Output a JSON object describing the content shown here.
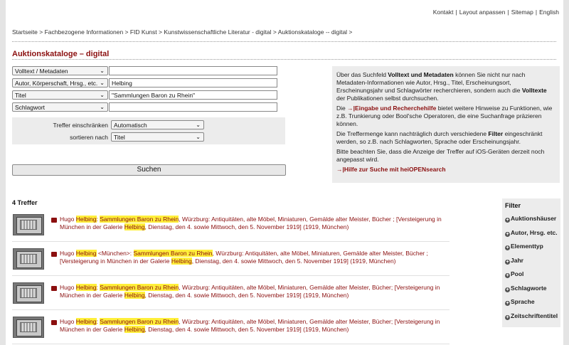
{
  "top_links": [
    "Kontakt",
    "Layout anpassen",
    "Sitemap",
    "English"
  ],
  "breadcrumb": "Startseite > Fachbezogene Informationen > FID Kunst > Kunstwissenschaftliche Literatur - digital > Auktionskataloge -- digital >",
  "page_title": "Auktionskataloge – digital",
  "search_rows": [
    {
      "field": "Volltext / Metadaten",
      "value": ""
    },
    {
      "field": "Autor, Körperschaft, Hrsg., etc.",
      "value": "Helbing"
    },
    {
      "field": "Titel",
      "value": "\"Sammlungen Baron zu Rhein\""
    },
    {
      "field": "Schlagwort",
      "value": ""
    }
  ],
  "limit": {
    "label": "Treffer einschränken",
    "value": "Automatisch"
  },
  "sort": {
    "label": "sortieren nach",
    "value": "Titel"
  },
  "search_button": "Suchen",
  "info": {
    "p1_a": "Über das Suchfeld ",
    "p1_b": "Volltext und Metadaten",
    "p1_c": " können Sie nicht nur nach Metadaten-Informationen wie Autor, Hrsg., Titel, Erscheinungsort, Erscheinungsjahr und Schlagwörter recherchieren, sondern auch die ",
    "p1_d": "Volltexte",
    "p1_e": " der Publikationen selbst durchsuchen.",
    "p2_a": "Die ",
    "p2_link": "Eingabe und Recherchehilfe",
    "p2_b": " bietet weitere Hinweise zu Funktionen, wie z.B. Trunkierung oder Bool'sche Operatoren, die eine Suchanfrage präzieren können.",
    "p3_a": "Die Treffermenge kann nachträglich durch verschiedene ",
    "p3_b": "Filter",
    "p3_c": " eingeschränkt werden, so z.B. nach Schlagworten, Sprache oder Erscheinungsjahr.",
    "p4": "Bitte beachten Sie, dass die Anzeige der Treffer auf iOS-Geräten derzeit noch angepasst wird.",
    "help_link": "Hilfe zur Suche mit heiOPENsearch"
  },
  "result_count": "4 Treffer",
  "results": [
    {
      "a": "Hugo ",
      "b": "Helbing",
      "c": ": ",
      "d": "Sammlungen Baron zu Rhein",
      "e": ", Würzburg: Antiquitäten, alte Möbel, Miniaturen, Gemälde alter Meister, Bücher ; [Versteigerung in München in der Galerie ",
      "f": "Helbing",
      "g": ", Dienstag, den 4. sowie Mittwoch, den 5. November 1919] (1919, München)"
    },
    {
      "a": "Hugo ",
      "b": "Helbing",
      "c": " <München>: ",
      "d": "Sammlungen Baron zu Rhein",
      "e": ", Würzburg: Antiquitäten, alte Möbel, Miniaturen, Gemälde alter Meister, Bücher ; [Versteigerung in München in der Galerie ",
      "f": "Helbing",
      "g": ", Dienstag, den 4. sowie Mittwoch, den 5. November 1919] (1919, München)"
    },
    {
      "a": "Hugo ",
      "b": "Helbing",
      "c": ": ",
      "d": "Sammlungen Baron zu Rhein",
      "e": ", Würzburg: Antiquitäten, alte Möbel, Miniaturen, Gemälde alter Meister, Bücher; [Versteigerung in München in der Galerie ",
      "f": "Helbing",
      "g": ", Dienstag, den 4. sowie Mittwoch, den 5. November 1919] (1919, München)"
    },
    {
      "a": "Hugo ",
      "b": "Helbing",
      "c": ": ",
      "d": "Sammlungen Baron zu Rhein",
      "e": ", Würzburg: Antiquitäten, alte Möbel, Miniaturen, Gemälde alter Meister, Bücher; [Versteigerung in München in der Galerie ",
      "f": "Helbing",
      "g": ", Dienstag, den 4. sowie Mittwoch, den 5. November 1919] (1919, München)"
    }
  ],
  "filter": {
    "title": "Filter",
    "items": [
      "Auktionshäuser",
      "Autor, Hrsg. etc.",
      "Elementtyp",
      "Jahr",
      "Pool",
      "Schlagworte",
      "Sprache",
      "Zeitschriftentitel"
    ]
  },
  "colors": {
    "accent": "#8b0f0f",
    "highlight": "#ffef3a",
    "panel": "#ececec"
  }
}
